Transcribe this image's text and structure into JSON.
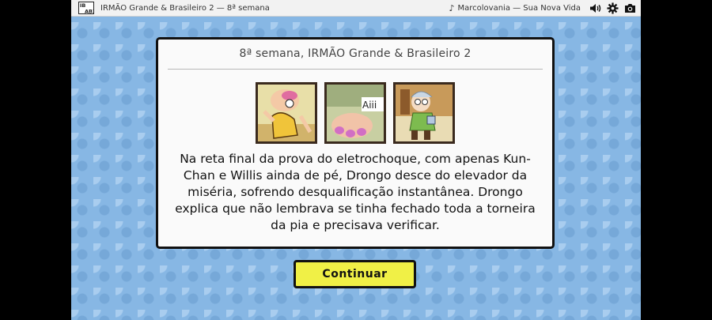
{
  "topbar": {
    "logo_text": "IBAB2",
    "title": "IRMÃO Grande & Brasileiro 2 — 8ª semana",
    "now_playing": "Marcolovania — Sua Nova Vida",
    "icons": [
      "music-note-icon",
      "speaker-icon",
      "gear-icon",
      "camera-icon"
    ]
  },
  "card": {
    "header": "8ª semana, IRMÃO Grande & Brasileiro 2",
    "thumb2_caption": "Aiii",
    "text": "Na reta final da prova do eletrochoque, com apenas Kun-Chan e Willis ainda de pé, Drongo desce do elevador da miséria, sofrendo desqualificação instantânea. Drongo explica que não lembrava se tinha fechado toda a torneira da pia e precisava verificar."
  },
  "buttons": {
    "continue_label": "Continuar"
  }
}
